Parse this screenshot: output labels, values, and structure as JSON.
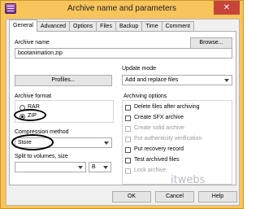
{
  "window": {
    "title": "Archive name and parameters",
    "close_glyph": "✕",
    "icon": "winrar-icon"
  },
  "tabs": [
    "General",
    "Advanced",
    "Options",
    "Files",
    "Backup",
    "Time",
    "Comment"
  ],
  "archive_name": {
    "label": "Archive name",
    "value": "bootanimation.zip",
    "browse_label": "Browse..."
  },
  "profiles_label": "Profiles...",
  "update_mode": {
    "label": "Update mode",
    "value": "Add and replace files"
  },
  "archive_format": {
    "label": "Archive format",
    "options": [
      "RAR",
      "ZIP"
    ],
    "selected": "ZIP"
  },
  "compression": {
    "label": "Compression method",
    "value": "Store"
  },
  "split": {
    "label": "Split to volumes, size",
    "value": "",
    "unit": "B"
  },
  "archiving_options": {
    "label": "Archiving options",
    "items": [
      {
        "label": "Delete files after archiving",
        "checked": false,
        "enabled": true
      },
      {
        "label": "Create SFX archive",
        "checked": false,
        "enabled": true
      },
      {
        "label": "Create solid archive",
        "checked": false,
        "enabled": false
      },
      {
        "label": "Put authenticity verification",
        "checked": false,
        "enabled": false
      },
      {
        "label": "Put recovery record",
        "checked": false,
        "enabled": true
      },
      {
        "label": "Test archived files",
        "checked": false,
        "enabled": true
      },
      {
        "label": "Lock archive",
        "checked": false,
        "enabled": false
      }
    ]
  },
  "buttons": {
    "ok": "OK",
    "cancel": "Cancel",
    "help": "Help"
  },
  "watermark": "itwebs",
  "colors": {
    "titlebar": "#f8c45c",
    "close": "#c7443a"
  }
}
